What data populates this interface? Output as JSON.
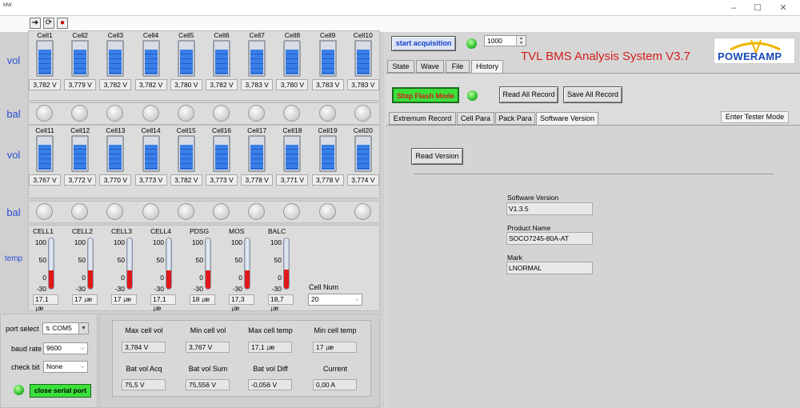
{
  "titlebar": {
    "logo_text": "MW"
  },
  "left": {
    "row_labels": {
      "vol": "vol",
      "bal": "bal",
      "temp": "temp"
    },
    "cells_top": [
      {
        "name": "Cell1",
        "value": "3,782 V",
        "level": 0.75
      },
      {
        "name": "Cell2",
        "value": "3,779 V",
        "level": 0.75
      },
      {
        "name": "Cell3",
        "value": "3,782 V",
        "level": 0.75
      },
      {
        "name": "Cell4",
        "value": "3,782 V",
        "level": 0.75
      },
      {
        "name": "Cell5",
        "value": "3,780 V",
        "level": 0.75
      },
      {
        "name": "Cell6",
        "value": "3,782 V",
        "level": 0.75
      },
      {
        "name": "Cell7",
        "value": "3,783 V",
        "level": 0.75
      },
      {
        "name": "Cell8",
        "value": "3,780 V",
        "level": 0.75
      },
      {
        "name": "Cell9",
        "value": "3,783 V",
        "level": 0.75
      },
      {
        "name": "Cell10",
        "value": "3,783 V",
        "level": 0.75
      }
    ],
    "cells_bottom": [
      {
        "name": "Cell11",
        "value": "3,767 V",
        "level": 0.75
      },
      {
        "name": "Cell12",
        "value": "3,772 V",
        "level": 0.75
      },
      {
        "name": "Cell13",
        "value": "3,770 V",
        "level": 0.75
      },
      {
        "name": "Cell14",
        "value": "3,773 V",
        "level": 0.75
      },
      {
        "name": "Cell15",
        "value": "3,782 V",
        "level": 0.75
      },
      {
        "name": "Cell16",
        "value": "3,773 V",
        "level": 0.75
      },
      {
        "name": "Cell17",
        "value": "3,778 V",
        "level": 0.75
      },
      {
        "name": "Cell18",
        "value": "3,771 V",
        "level": 0.75
      },
      {
        "name": "Cell19",
        "value": "3,778 V",
        "level": 0.75
      },
      {
        "name": "Cell20",
        "value": "3,774 V",
        "level": 0.75
      }
    ],
    "thermometers": [
      {
        "name": "CELL1",
        "value": "17,1 ¡æ",
        "level": 17.1
      },
      {
        "name": "CELL2",
        "value": "17 ¡æ",
        "level": 17
      },
      {
        "name": "CELL3",
        "value": "17 ¡æ",
        "level": 17
      },
      {
        "name": "CELL4",
        "value": "17,1 ¡æ",
        "level": 17.1
      },
      {
        "name": "PDSG",
        "value": "18 ¡æ",
        "level": 18
      },
      {
        "name": "MOS",
        "value": "17,3 ¡æ",
        "level": 17.3
      },
      {
        "name": "BALC",
        "value": "18,7 ¡æ",
        "level": 18.7
      }
    ],
    "therm_ticks": [
      "100",
      "50",
      "0",
      "-30"
    ],
    "cell_num": {
      "label": "Cell Num",
      "value": "20"
    },
    "port": {
      "port_label": "port select",
      "port_value": "COM5",
      "baud_label": "baud rate",
      "baud_value": "9600",
      "check_label": "check bit",
      "check_value": "None",
      "close_button": "close serial port"
    },
    "stats": {
      "headers1": [
        "Max cell vol",
        "Min cell vol",
        "Max cell temp",
        "Min cell temp"
      ],
      "values1": [
        "3,784 V",
        "3,767 V",
        "17,1 ¡æ",
        "17 ¡æ"
      ],
      "headers2": [
        "Bat vol Acq",
        "Bat vol Sum",
        "Bat vol Diff",
        "Current"
      ],
      "values2": [
        "75,5 V",
        "75,556 V",
        "-0,056 V",
        "0,00 A"
      ]
    }
  },
  "right": {
    "start_button": "start acquisition",
    "interval_value": "1000",
    "app_title": "TVL BMS Analysis System V3.7",
    "logo_text": "POWERAMP",
    "tabs": [
      "State",
      "Wave",
      "File",
      "History"
    ],
    "stop_flash_button": "Stop Flash Mode",
    "read_all_button": "Read All Record",
    "save_all_button": "Save All Record",
    "subtabs": [
      "Extremum Record",
      "Cell Para",
      "Pack Para",
      "Software Version"
    ],
    "enter_tester_button": "Enter Tester Mode",
    "read_version_button": "Read Version",
    "software_version_label": "Software Version",
    "software_version_value": "V1.3.5",
    "product_name_label": "Product Name",
    "product_name_value": "SOCO7245-80A-AT",
    "mark_label": "Mark",
    "mark_value": "LNORMAL"
  },
  "colors": {
    "accent_blue": "#2a4fd6",
    "green_button": "#3be03b",
    "title_red": "#d41c1c",
    "thermo_red": "#e01818",
    "battery_blue": "#2f6fd8"
  }
}
